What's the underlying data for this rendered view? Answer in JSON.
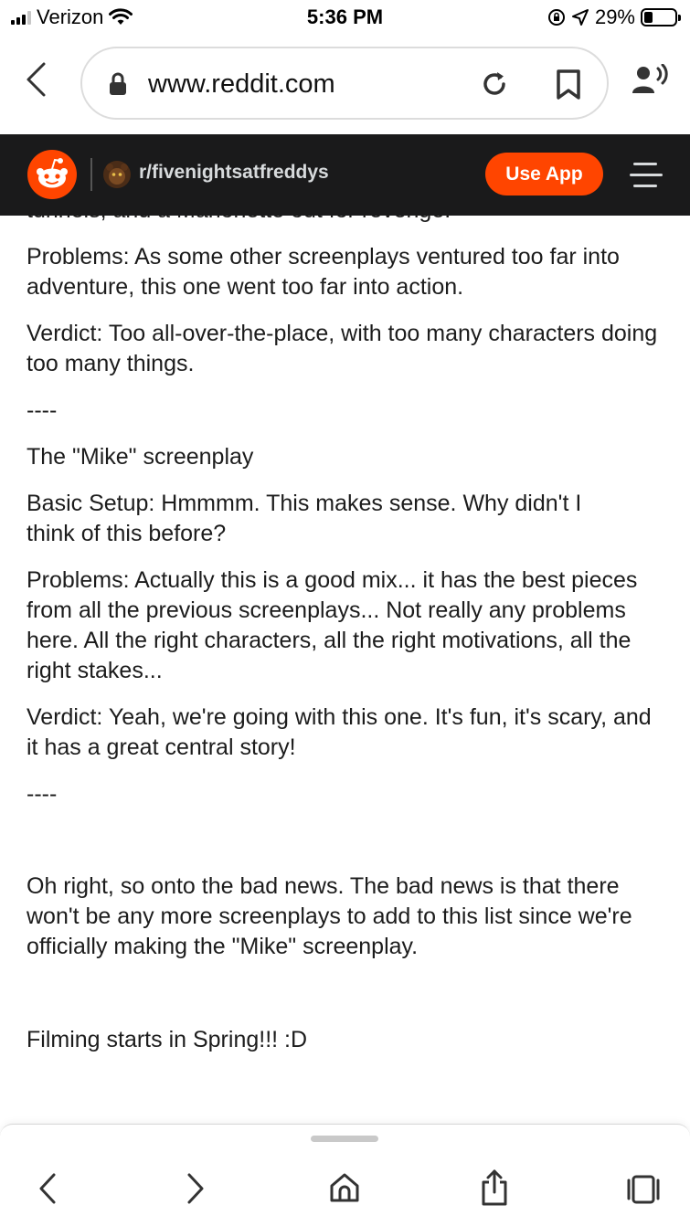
{
  "status_bar": {
    "carrier": "Verizon",
    "time": "5:36 PM",
    "battery_percent": "29%",
    "battery_level": 0.29
  },
  "browser": {
    "url": "www.reddit.com",
    "icons": [
      "chevron-left-icon",
      "lock-icon",
      "reload-icon",
      "bookmark-icon",
      "reader-voice-icon"
    ]
  },
  "reddit_header": {
    "subreddit": "r/fivenightsatfreddys",
    "use_app_label": "Use App",
    "brand_color": "#ff4500",
    "header_bg": "#1a1a1b"
  },
  "post": {
    "clipped_line": "tunnels, and a Marionette out for revenge.",
    "problems_1": "Problems: As some other screenplays ventured too far into adventure, this one went too far into action.",
    "verdict_1": "Verdict: Too all-over-the-place, with too many characters doing too many things.",
    "divider_1": "----",
    "mike_title": "The \"Mike\" screenplay",
    "mike_setup": "Basic Setup: Hmmmm. This makes sense. Why didn't I think of this before?",
    "mike_problems": "Problems: Actually this is a good mix... it has the best pieces from all the previous screenplays... Not really any problems here. All the right characters, all the right motivations, all the right stakes...",
    "mike_verdict": "Verdict: Yeah, we're going with this one. It's fun, it's scary, and it has a great central story!",
    "divider_2": "----",
    "bad_news": "Oh right, so onto the bad news. The bad news is that there won't be any more screenplays to add to this list since we're officially making the \"Mike\" screenplay.",
    "filming": "Filming starts in Spring!!! :D"
  },
  "toolbar": {
    "icons": [
      "back-icon",
      "forward-icon",
      "home-icon",
      "share-icon",
      "tabs-icon"
    ]
  }
}
